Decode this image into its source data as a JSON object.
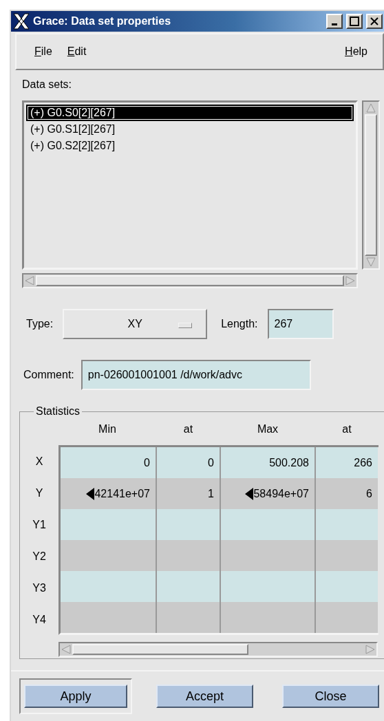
{
  "window": {
    "title": "Grace: Data set properties"
  },
  "menu": {
    "left": [
      {
        "label": "File"
      },
      {
        "label": "Edit"
      }
    ],
    "right": [
      {
        "label": "Help"
      }
    ]
  },
  "data_sets": {
    "label": "Data sets:",
    "items": [
      {
        "label": "(+) G0.S0[2][267]",
        "selected": true
      },
      {
        "label": "(+) G0.S1[2][267]",
        "selected": false
      },
      {
        "label": "(+) G0.S2[2][267]",
        "selected": false
      }
    ]
  },
  "type": {
    "label": "Type:",
    "value": "XY"
  },
  "length": {
    "label": "Length:",
    "value": "267"
  },
  "comment": {
    "label": "Comment:",
    "value": "pn-026001001001 /d/work/advc"
  },
  "statistics": {
    "title": "Statistics",
    "columns": [
      "Min",
      "at",
      "Max",
      "at"
    ],
    "rows": [
      {
        "label": "X",
        "cells": [
          {
            "text": "0",
            "truncated": false
          },
          {
            "text": "0",
            "truncated": false
          },
          {
            "text": "500.208",
            "truncated": false
          },
          {
            "text": "266",
            "truncated": false
          }
        ]
      },
      {
        "label": "Y",
        "cells": [
          {
            "text": "42141e+07",
            "truncated": true
          },
          {
            "text": "1",
            "truncated": false
          },
          {
            "text": "58494e+07",
            "truncated": true
          },
          {
            "text": "6",
            "truncated": false
          }
        ]
      },
      {
        "label": "Y1",
        "cells": []
      },
      {
        "label": "Y2",
        "cells": []
      },
      {
        "label": "Y3",
        "cells": []
      },
      {
        "label": "Y4",
        "cells": []
      }
    ]
  },
  "buttons": [
    {
      "label": "Apply",
      "default": true
    },
    {
      "label": "Accept",
      "default": false
    },
    {
      "label": "Close",
      "default": false
    }
  ]
}
